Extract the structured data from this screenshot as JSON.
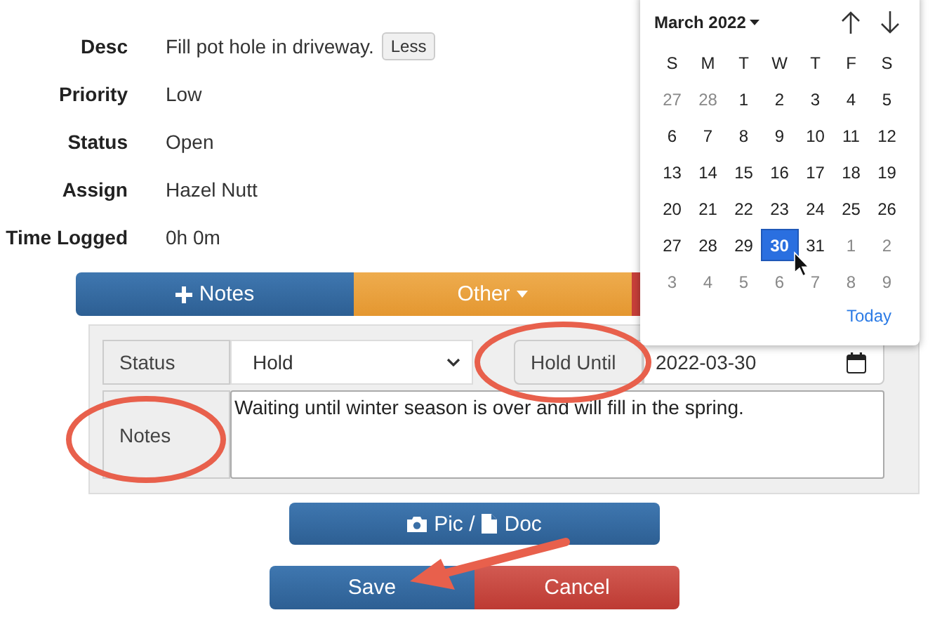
{
  "details": [
    {
      "label": "Desc",
      "value": "Fill pot hole in driveway.",
      "button": "Less"
    },
    {
      "label": "Priority",
      "value": "Low"
    },
    {
      "label": "Status",
      "value": "Open"
    },
    {
      "label": "Assign",
      "value": "Hazel Nutt"
    },
    {
      "label": "Time Logged",
      "value": "0h 0m"
    }
  ],
  "action_bar": [
    {
      "label": "Notes",
      "kind": "add"
    },
    {
      "label": "Other",
      "kind": "dropdown"
    }
  ],
  "form": {
    "status_label": "Status",
    "status_value": "Hold",
    "hold_label": "Hold Until",
    "hold_value": "2022-03-30",
    "notes_label": "Notes",
    "notes_value": "Waiting until winter season is over and will fill in the spring."
  },
  "attach_button": {
    "label_pic": "Pic /",
    "label_doc": "Doc"
  },
  "buttons": [
    {
      "label": "Save",
      "kind": "primary"
    },
    {
      "label": "Cancel",
      "kind": "danger"
    }
  ],
  "calendar": {
    "month": "March 2022",
    "weekdays": [
      "S",
      "M",
      "T",
      "W",
      "T",
      "F",
      "S"
    ],
    "days": [
      {
        "day": "27",
        "in_month": false,
        "selected": false
      },
      {
        "day": "28",
        "in_month": false,
        "selected": false
      },
      {
        "day": "1",
        "in_month": true,
        "selected": false
      },
      {
        "day": "2",
        "in_month": true,
        "selected": false
      },
      {
        "day": "3",
        "in_month": true,
        "selected": false
      },
      {
        "day": "4",
        "in_month": true,
        "selected": false
      },
      {
        "day": "5",
        "in_month": true,
        "selected": false
      },
      {
        "day": "6",
        "in_month": true,
        "selected": false
      },
      {
        "day": "7",
        "in_month": true,
        "selected": false
      },
      {
        "day": "8",
        "in_month": true,
        "selected": false
      },
      {
        "day": "9",
        "in_month": true,
        "selected": false
      },
      {
        "day": "10",
        "in_month": true,
        "selected": false
      },
      {
        "day": "11",
        "in_month": true,
        "selected": false
      },
      {
        "day": "12",
        "in_month": true,
        "selected": false
      },
      {
        "day": "13",
        "in_month": true,
        "selected": false
      },
      {
        "day": "14",
        "in_month": true,
        "selected": false
      },
      {
        "day": "15",
        "in_month": true,
        "selected": false
      },
      {
        "day": "16",
        "in_month": true,
        "selected": false
      },
      {
        "day": "17",
        "in_month": true,
        "selected": false
      },
      {
        "day": "18",
        "in_month": true,
        "selected": false
      },
      {
        "day": "19",
        "in_month": true,
        "selected": false
      },
      {
        "day": "20",
        "in_month": true,
        "selected": false
      },
      {
        "day": "21",
        "in_month": true,
        "selected": false
      },
      {
        "day": "22",
        "in_month": true,
        "selected": false
      },
      {
        "day": "23",
        "in_month": true,
        "selected": false
      },
      {
        "day": "24",
        "in_month": true,
        "selected": false
      },
      {
        "day": "25",
        "in_month": true,
        "selected": false
      },
      {
        "day": "26",
        "in_month": true,
        "selected": false
      },
      {
        "day": "27",
        "in_month": true,
        "selected": false
      },
      {
        "day": "28",
        "in_month": true,
        "selected": false
      },
      {
        "day": "29",
        "in_month": true,
        "selected": false
      },
      {
        "day": "30",
        "in_month": true,
        "selected": true
      },
      {
        "day": "31",
        "in_month": true,
        "selected": false
      },
      {
        "day": "1",
        "in_month": false,
        "selected": false
      },
      {
        "day": "2",
        "in_month": false,
        "selected": false
      },
      {
        "day": "3",
        "in_month": false,
        "selected": false
      },
      {
        "day": "4",
        "in_month": false,
        "selected": false
      },
      {
        "day": "5",
        "in_month": false,
        "selected": false
      },
      {
        "day": "6",
        "in_month": false,
        "selected": false
      },
      {
        "day": "7",
        "in_month": false,
        "selected": false
      },
      {
        "day": "8",
        "in_month": false,
        "selected": false
      },
      {
        "day": "9",
        "in_month": false,
        "selected": false
      }
    ],
    "today": "Today"
  }
}
